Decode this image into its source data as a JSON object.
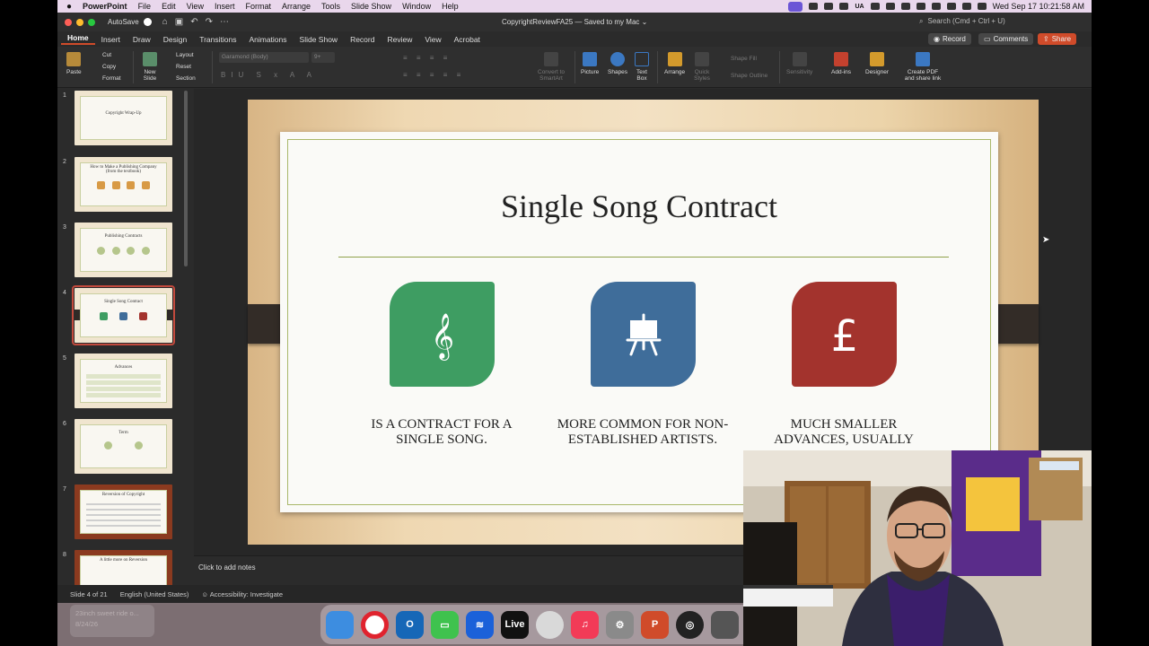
{
  "menubar": {
    "app": "PowerPoint",
    "items": [
      "File",
      "Edit",
      "View",
      "Insert",
      "Format",
      "Arrange",
      "Tools",
      "Slide Show",
      "Window",
      "Help"
    ],
    "clock": "Wed Sep 17  10:21:58 AM",
    "input_source": "UA"
  },
  "window": {
    "autosave_label": "AutoSave",
    "doc_title": "CopyrightReviewFA25 — Saved to my Mac ⌄",
    "search_placeholder": "Search (Cmd + Ctrl + U)"
  },
  "ribbon_tabs": [
    "Home",
    "Insert",
    "Draw",
    "Design",
    "Transitions",
    "Animations",
    "Slide Show",
    "Record",
    "Review",
    "View",
    "Acrobat"
  ],
  "ribbon_buttons": {
    "record": "Record",
    "comments": "Comments",
    "share": "Share"
  },
  "ribbon": {
    "paste": "Paste",
    "cut": "Cut",
    "copy": "Copy",
    "format": "Format",
    "new_slide": "New Slide",
    "layout": "Layout",
    "reset": "Reset",
    "section": "Section",
    "font": "Garamond (Body)",
    "font_size": "9+",
    "convert_smartart": "Convert to SmartArt",
    "picture": "Picture",
    "shapes": "Shapes",
    "text_box": "Text Box",
    "arrange": "Arrange",
    "quick_styles": "Quick Styles",
    "shape_fill": "Shape Fill",
    "shape_outline": "Shape Outline",
    "sensitivity": "Sensitivity",
    "add_ins": "Add-ins",
    "designer": "Designer",
    "create_pdf": "Create PDF and share link"
  },
  "thumbnails": [
    {
      "num": "1",
      "title": "Copyright Wrap-Up"
    },
    {
      "num": "2",
      "title": "How to Make a Publishing Company (from the textbook)"
    },
    {
      "num": "3",
      "title": "Publishing Contracts"
    },
    {
      "num": "4",
      "title": "Single Song Contract"
    },
    {
      "num": "5",
      "title": "Advances"
    },
    {
      "num": "6",
      "title": "Term"
    },
    {
      "num": "7",
      "title": "Reversion of Copyright"
    },
    {
      "num": "8",
      "title": "A little more on Reversion"
    }
  ],
  "slide": {
    "title": "Single Song Contract",
    "columns": [
      {
        "icon": "treble-clef-icon",
        "color": "#3e9d62",
        "caption": "IS A CONTRACT FOR A SINGLE SONG."
      },
      {
        "icon": "easel-icon",
        "color": "#3f6d9a",
        "caption": "MORE COMMON FOR NON-ESTABLISHED ARTISTS."
      },
      {
        "icon": "pound-icon",
        "color": "#a3332d",
        "caption": "MUCH SMALLER ADVANCES, USUALLY"
      }
    ]
  },
  "notes_placeholder": "Click to add notes",
  "status": {
    "slide_counter": "Slide 4 of 21",
    "language": "English (United States)",
    "accessibility": "Accessibility: Investigate"
  },
  "dock": {
    "live_label": "Live",
    "ghost_text": "23inch sweet ride o...",
    "ghost_date": "8/24/26"
  },
  "colors": {
    "accent": "#d04b2a",
    "selection": "#c34a3d",
    "rule": "#8fa04a"
  }
}
